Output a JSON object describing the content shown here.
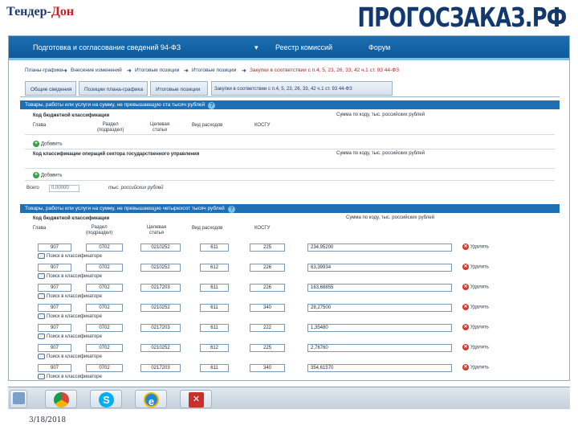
{
  "header": {
    "brand_left_1": "Тендер-",
    "brand_left_2": "Дон",
    "brand_right": "ПРОГОСЗАКАЗ.РФ"
  },
  "topnav": {
    "item1": "Подготовка и согласование сведений 94-ФЗ",
    "dropdown": "▾",
    "item2": "Реестр комиссий",
    "item3": "Форум"
  },
  "breadcrumbs": [
    "Планы-графики",
    "Внесение изменений",
    "Итоговые позиции",
    "Итоговые позиции",
    "Закупки в соответствии с п.4, 5, 23, 26, 33, 42 ч.1 ст. 93 44-ФЗ"
  ],
  "tabs": [
    "Общие сведения",
    "Позиции плана-графика",
    "Итоговые позиции",
    "Закупки в соответствии с п.4, 5, 23, 26, 33, 42 ч.1 ст. 93 44-ФЗ"
  ],
  "section1": {
    "title": "Товары, работы или услуги на сумму, не превышающую ста тысяч рублей",
    "kbk_title": "Код бюджетной классификации",
    "col_glava": "Глава",
    "col_razdel": "Раздел\n(подраздел)",
    "col_cel": "Целевая\nстатья",
    "col_vid": "Вид расходов",
    "col_kosgu": "КОСГУ",
    "col_sum": "Сумма по коду, тыс. российских рублей",
    "add1": "Добавить",
    "kosgu_title": "Код классификации операций сектора государственного управления",
    "col_sum2": "Сумма по коду, тыс. российских рублей",
    "add2": "Добавить",
    "total_label": "Всего",
    "total_value": "0,00000",
    "total_unit": "тыс. российских рублей"
  },
  "section2": {
    "title": "Товары, работы или услуги на сумму, не превышающую четырехсот тысяч рублей",
    "kbk_title": "Код бюджетной классификации",
    "col_glava": "Глава",
    "col_razdel": "Раздел\n(подраздел)",
    "col_cel": "Целевая\nстатья",
    "col_vid": "Вид расходов",
    "col_kosgu": "КОСГУ",
    "col_sum": "Сумма по коду, тыс. российских рублей",
    "search_label": "Поиск в классификаторе",
    "delete_label": "Удалить",
    "rows": [
      {
        "glava": "907",
        "razdel": "0702",
        "cel": "0210252",
        "vid": "611",
        "kosgu": "225",
        "sum": "234,95200"
      },
      {
        "glava": "907",
        "razdel": "0702",
        "cel": "0210252",
        "vid": "612",
        "kosgu": "226",
        "sum": "63,39934"
      },
      {
        "glava": "907",
        "razdel": "0702",
        "cel": "0217203",
        "vid": "611",
        "kosgu": "226",
        "sum": "163,68855"
      },
      {
        "glava": "907",
        "razdel": "0702",
        "cel": "0210252",
        "vid": "611",
        "kosgu": "340",
        "sum": "28,27500"
      },
      {
        "glava": "907",
        "razdel": "0702",
        "cel": "0217203",
        "vid": "611",
        "kosgu": "222",
        "sum": "1,35480"
      },
      {
        "glava": "907",
        "razdel": "0702",
        "cel": "0210252",
        "vid": "612",
        "kosgu": "225",
        "sum": "2,76760"
      },
      {
        "glava": "907",
        "razdel": "0702",
        "cel": "0217203",
        "vid": "611",
        "kosgu": "340",
        "sum": "354,61570"
      }
    ]
  },
  "taskbar": {
    "icons": [
      "start-icon",
      "chrome-icon",
      "skype-icon",
      "ie-icon",
      "pdf-icon"
    ]
  },
  "footer": {
    "date": "3/18/2018"
  }
}
